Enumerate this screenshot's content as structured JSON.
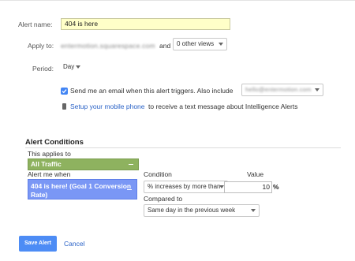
{
  "alert_name": {
    "label": "Alert name:",
    "value": "404 is here"
  },
  "apply_to": {
    "label": "Apply to:",
    "property": "entermotion.squarespace.com",
    "and_text": "and",
    "views_select": "0 other views"
  },
  "period": {
    "label": "Period:",
    "value": "Day"
  },
  "email_option": {
    "checked": true,
    "text": "Send me an email when this alert triggers. Also include",
    "email_select": "hello@entermotion.com"
  },
  "mobile_option": {
    "link_text": "Setup your mobile phone",
    "rest_text": "to receive a text message about Intelligence Alerts"
  },
  "conditions": {
    "title": "Alert Conditions",
    "applies_label": "This applies to",
    "applies_value": "All Traffic",
    "alert_me_label": "Alert me when",
    "alert_me_value": "404 is here! (Goal 1 Conversion Rate)",
    "condition_label": "Condition",
    "condition_value": "% increases by more than",
    "value_label": "Value",
    "value_value": "10",
    "value_unit": "%",
    "compared_label": "Compared to",
    "compared_value": "Same day in the previous week"
  },
  "actions": {
    "save": "Save Alert",
    "cancel": "Cancel"
  },
  "colors": {
    "accent_blue": "#4d8cf5",
    "segment_green": "#8eb25f",
    "metric_blue": "#7a97f5",
    "name_highlight": "#ffffc8"
  }
}
